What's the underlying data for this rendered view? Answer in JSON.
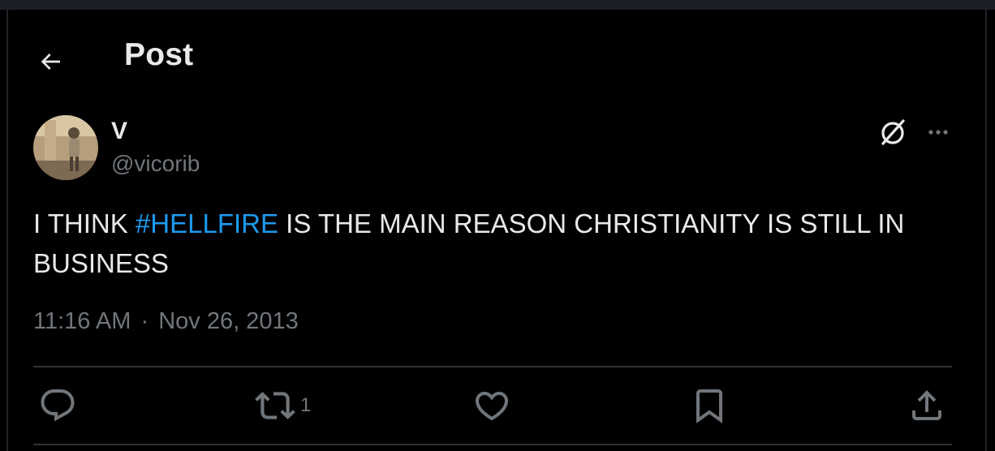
{
  "header": {
    "title": "Post",
    "back_icon": "arrow-left-icon"
  },
  "post": {
    "author": {
      "name": "V",
      "handle": "@vicorib"
    },
    "text_before": "I THINK ",
    "hashtag": "#HELLFIRE",
    "text_after": " IS THE MAIN REASON CHRISTIANITY IS STILL IN BUSINESS",
    "time": "11:16 AM",
    "separator": "·",
    "date": "Nov 26, 2013"
  },
  "actions": {
    "reply_icon": "reply-icon",
    "repost_icon": "repost-icon",
    "repost_count": "1",
    "like_icon": "heart-icon",
    "bookmark_icon": "bookmark-icon",
    "share_icon": "share-icon"
  },
  "colors": {
    "background": "#000000",
    "text": "#e7e9ea",
    "secondary": "#71767b",
    "accent": "#1d9bf0",
    "border": "#2f3336"
  }
}
